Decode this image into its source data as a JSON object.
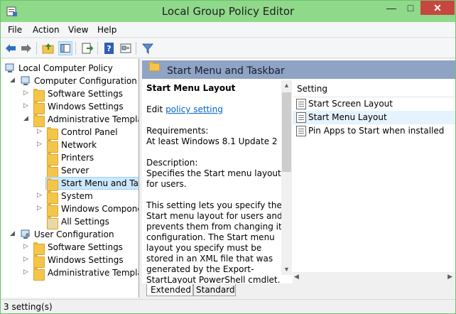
{
  "window": {
    "title": "Local Group Policy Editor"
  },
  "menu": [
    "File",
    "Action",
    "View",
    "Help"
  ],
  "tree": [
    {
      "label": "Local Computer Policy",
      "icon": "computer-policy-icon",
      "expander": ""
    },
    {
      "label": "Computer Configuration",
      "icon": "computer-icon",
      "expander": "open"
    },
    {
      "label": "Software Settings",
      "icon": "folder-icon",
      "expander": "closed"
    },
    {
      "label": "Windows Settings",
      "icon": "folder-icon",
      "expander": "closed"
    },
    {
      "label": "Administrative Templates",
      "icon": "folder-icon",
      "expander": "open"
    },
    {
      "label": "Control Panel",
      "icon": "folder-icon",
      "expander": "closed"
    },
    {
      "label": "Network",
      "icon": "folder-icon",
      "expander": "closed"
    },
    {
      "label": "Printers",
      "icon": "folder-icon",
      "expander": ""
    },
    {
      "label": "Server",
      "icon": "folder-icon",
      "expander": ""
    },
    {
      "label": "Start Menu and Taskbar",
      "icon": "folder-icon",
      "expander": "",
      "selected": true
    },
    {
      "label": "System",
      "icon": "folder-icon",
      "expander": "closed"
    },
    {
      "label": "Windows Components",
      "icon": "folder-icon",
      "expander": "closed"
    },
    {
      "label": "All Settings",
      "icon": "settings-folder-icon",
      "expander": ""
    },
    {
      "label": "User Configuration",
      "icon": "user-icon",
      "expander": "open"
    },
    {
      "label": "Software Settings",
      "icon": "folder-icon",
      "expander": "closed"
    },
    {
      "label": "Windows Settings",
      "icon": "folder-icon",
      "expander": "closed"
    },
    {
      "label": "Administrative Templates",
      "icon": "folder-icon",
      "expander": "closed"
    }
  ],
  "panel": {
    "header": "Start Menu and Taskbar",
    "description": {
      "title": "Start Menu Layout",
      "edit_prefix": "Edit ",
      "edit_link": "policy setting",
      "requirements_label": "Requirements:",
      "requirements": "At least Windows 8.1 Update 2",
      "description_label": "Description:",
      "description": "Specifies the Start menu layout for users.",
      "body": "This setting lets you specify the Start menu layout for users and prevents them from changing its configuration. The Start menu layout you specify must be stored in an XML file that was generated by the Export-StartLayout PowerShell cmdlet."
    },
    "column_header": "Setting",
    "settings": [
      {
        "label": "Start Screen Layout",
        "selected": false
      },
      {
        "label": "Start Menu Layout",
        "selected": true
      },
      {
        "label": "Pin Apps to Start when installed",
        "selected": false
      }
    ],
    "tabs": [
      "Extended",
      "Standard"
    ]
  },
  "status": "3 setting(s)"
}
